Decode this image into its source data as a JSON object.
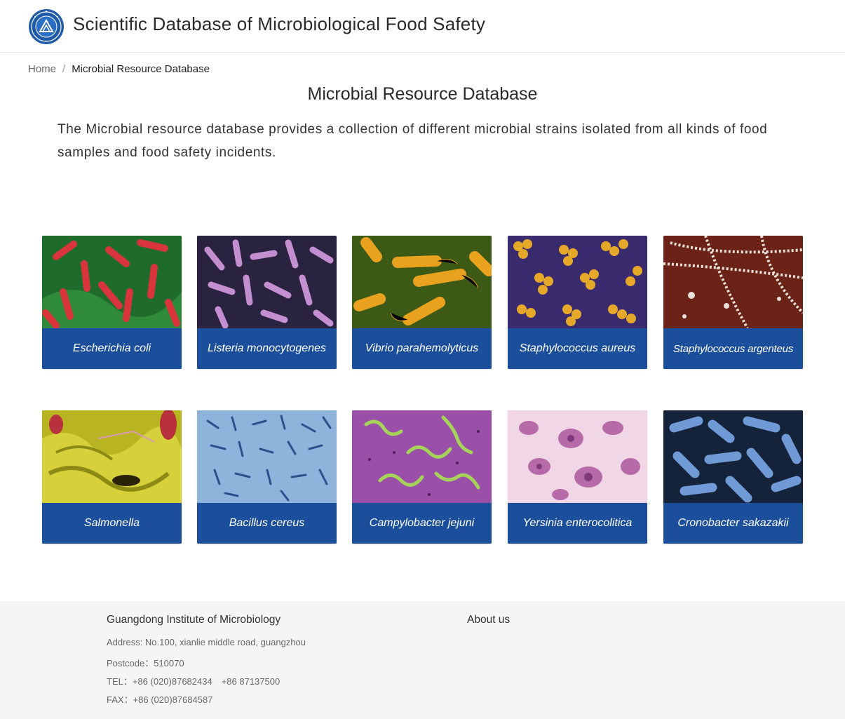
{
  "header": {
    "logo_icon": "institute-seal-logo",
    "title": "Scientific Database of Microbiological Food Safety"
  },
  "breadcrumb": {
    "home": "Home",
    "separator": "/",
    "current": "Microbial Resource Database"
  },
  "page": {
    "title": "Microbial Resource Database",
    "intro": "The Microbial resource database provides a collection of different microbial strains isolated from all kinds of food samples and food safety incidents."
  },
  "microbes": [
    {
      "name": "Escherichia coli"
    },
    {
      "name": "Listeria monocytogenes"
    },
    {
      "name": "Vibrio parahemolyticus"
    },
    {
      "name": "Staphylococcus aureus"
    },
    {
      "name": "Staphylococcus argenteus"
    },
    {
      "name": "Salmonella"
    },
    {
      "name": "Bacillus cereus"
    },
    {
      "name": "Campylobacter jejuni"
    },
    {
      "name": "Yersinia enterocolitica"
    },
    {
      "name": "Cronobacter sakazakii"
    }
  ],
  "footer": {
    "org": "Guangdong Institute of Microbiology",
    "about": "About us",
    "address": "Address: No.100, xianlie middle road, guangzhou",
    "postcode": "Postcode：510070",
    "tel": "TEL：+86 (020)87682434　+86 87137500",
    "fax": "FAX：+86 (020)87684587"
  },
  "colors": {
    "card_label_bg": "#1b4f9c",
    "footer_bg": "#f5f5f5"
  }
}
